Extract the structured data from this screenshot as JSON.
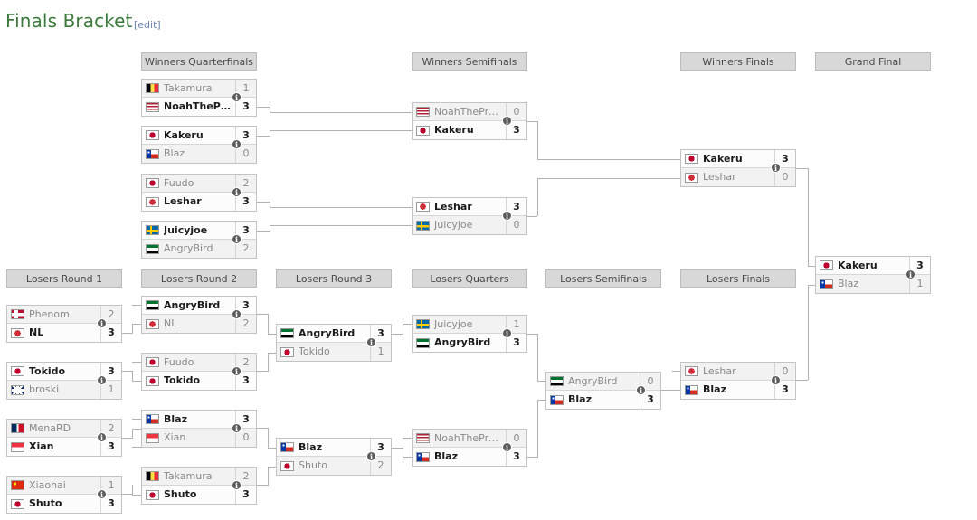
{
  "title": "Finals Bracket",
  "edit_label": "[edit]",
  "theme": {
    "title_color": "#3c7a3c",
    "link_color": "#6a86b3",
    "header_bg": "#d8d8d8",
    "winner_text": "#1b1b1b",
    "loser_text": "#8a8a8a"
  },
  "rounds": {
    "wqf": {
      "label": "Winners Quarterfinals"
    },
    "wsf": {
      "label": "Winners Semifinals"
    },
    "wf": {
      "label": "Winners Finals"
    },
    "gf": {
      "label": "Grand Final"
    },
    "lr1": {
      "label": "Losers Round 1"
    },
    "lr2": {
      "label": "Losers Round 2"
    },
    "lr3": {
      "label": "Losers Round 3"
    },
    "lqf": {
      "label": "Losers Quarters"
    },
    "lsf": {
      "label": "Losers Semifinals"
    },
    "lf": {
      "label": "Losers Finals"
    }
  },
  "matches": {
    "wqf1": {
      "top": {
        "name": "Takamura",
        "score": "1",
        "flag": "be",
        "winner": false
      },
      "bot": {
        "name": "NoahTheProdigy",
        "score": "3",
        "flag": "us",
        "winner": true
      }
    },
    "wqf2": {
      "top": {
        "name": "Kakeru",
        "score": "3",
        "flag": "jp",
        "winner": true
      },
      "bot": {
        "name": "Blaz",
        "score": "0",
        "flag": "cl",
        "winner": false
      }
    },
    "wqf3": {
      "top": {
        "name": "Fuudo",
        "score": "2",
        "flag": "jp",
        "winner": false
      },
      "bot": {
        "name": "Leshar",
        "score": "3",
        "flag": "kr",
        "winner": true
      }
    },
    "wqf4": {
      "top": {
        "name": "Juicyjoe",
        "score": "3",
        "flag": "se",
        "winner": true
      },
      "bot": {
        "name": "AngryBird",
        "score": "2",
        "flag": "ae",
        "winner": false
      }
    },
    "wsf1": {
      "top": {
        "name": "NoahTheProdigy",
        "score": "0",
        "flag": "us",
        "winner": false
      },
      "bot": {
        "name": "Kakeru",
        "score": "3",
        "flag": "jp",
        "winner": true
      }
    },
    "wsf2": {
      "top": {
        "name": "Leshar",
        "score": "3",
        "flag": "kr",
        "winner": true
      },
      "bot": {
        "name": "Juicyjoe",
        "score": "0",
        "flag": "se",
        "winner": false
      }
    },
    "wf1": {
      "top": {
        "name": "Kakeru",
        "score": "3",
        "flag": "jp",
        "winner": true
      },
      "bot": {
        "name": "Leshar",
        "score": "0",
        "flag": "kr",
        "winner": false
      }
    },
    "gf1": {
      "top": {
        "name": "Kakeru",
        "score": "3",
        "flag": "jp",
        "winner": true
      },
      "bot": {
        "name": "Blaz",
        "score": "1",
        "flag": "cl",
        "winner": false
      }
    },
    "lr1a": {
      "top": {
        "name": "Phenom",
        "score": "2",
        "flag": "no",
        "winner": false
      },
      "bot": {
        "name": "NL",
        "score": "3",
        "flag": "kr",
        "winner": true
      }
    },
    "lr1b": {
      "top": {
        "name": "Tokido",
        "score": "3",
        "flag": "jp",
        "winner": true
      },
      "bot": {
        "name": "broski",
        "score": "1",
        "flag": "gb",
        "winner": false
      }
    },
    "lr1c": {
      "top": {
        "name": "MenaRD",
        "score": "2",
        "flag": "do",
        "winner": false
      },
      "bot": {
        "name": "Xian",
        "score": "3",
        "flag": "sg",
        "winner": true
      }
    },
    "lr1d": {
      "top": {
        "name": "Xiaohai",
        "score": "1",
        "flag": "cn",
        "winner": false
      },
      "bot": {
        "name": "Shuto",
        "score": "3",
        "flag": "jp",
        "winner": true
      }
    },
    "lr2a": {
      "top": {
        "name": "AngryBird",
        "score": "3",
        "flag": "ae",
        "winner": true
      },
      "bot": {
        "name": "NL",
        "score": "2",
        "flag": "kr",
        "winner": false
      }
    },
    "lr2b": {
      "top": {
        "name": "Fuudo",
        "score": "2",
        "flag": "jp",
        "winner": false
      },
      "bot": {
        "name": "Tokido",
        "score": "3",
        "flag": "jp",
        "winner": true
      }
    },
    "lr2c": {
      "top": {
        "name": "Blaz",
        "score": "3",
        "flag": "cl",
        "winner": true
      },
      "bot": {
        "name": "Xian",
        "score": "0",
        "flag": "sg",
        "winner": false
      }
    },
    "lr2d": {
      "top": {
        "name": "Takamura",
        "score": "2",
        "flag": "be",
        "winner": false
      },
      "bot": {
        "name": "Shuto",
        "score": "3",
        "flag": "jp",
        "winner": true
      }
    },
    "lr3a": {
      "top": {
        "name": "AngryBird",
        "score": "3",
        "flag": "ae",
        "winner": true
      },
      "bot": {
        "name": "Tokido",
        "score": "1",
        "flag": "jp",
        "winner": false
      }
    },
    "lr3b": {
      "top": {
        "name": "Blaz",
        "score": "3",
        "flag": "cl",
        "winner": true
      },
      "bot": {
        "name": "Shuto",
        "score": "2",
        "flag": "jp",
        "winner": false
      }
    },
    "lqf1": {
      "top": {
        "name": "Juicyjoe",
        "score": "1",
        "flag": "se",
        "winner": false
      },
      "bot": {
        "name": "AngryBird",
        "score": "3",
        "flag": "ae",
        "winner": true
      }
    },
    "lqf2": {
      "top": {
        "name": "NoahTheProdigy",
        "score": "0",
        "flag": "us",
        "winner": false
      },
      "bot": {
        "name": "Blaz",
        "score": "3",
        "flag": "cl",
        "winner": true
      }
    },
    "lsf1": {
      "top": {
        "name": "AngryBird",
        "score": "0",
        "flag": "ae",
        "winner": false
      },
      "bot": {
        "name": "Blaz",
        "score": "3",
        "flag": "cl",
        "winner": true
      }
    },
    "lf1": {
      "top": {
        "name": "Leshar",
        "score": "0",
        "flag": "kr",
        "winner": false
      },
      "bot": {
        "name": "Blaz",
        "score": "3",
        "flag": "cl",
        "winner": true
      }
    }
  },
  "info_icon": "i"
}
